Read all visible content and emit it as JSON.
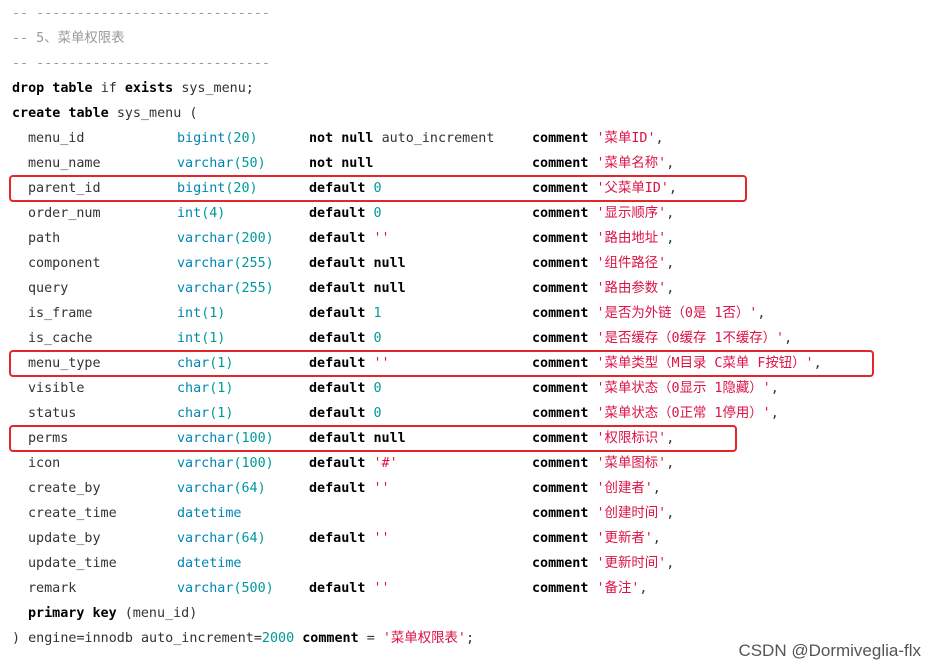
{
  "header": {
    "sep1": "-- -----------------------------",
    "title": "-- 5、菜单权限表",
    "sep2": "-- -----------------------------"
  },
  "drop": {
    "kw1": "drop table",
    "kw2": "if",
    "kw3": "exists",
    "name": "sys_menu;"
  },
  "create": {
    "kw": "create table",
    "name": "sys_menu ("
  },
  "rows": [
    {
      "name": "menu_id",
      "type": "bigint",
      "size": "(20)",
      "def_kw": "not null",
      "def_val": "auto_increment",
      "def_val_kind": "plain",
      "cmt_kw": "comment",
      "cmt": "'菜单ID'",
      "tail": ","
    },
    {
      "name": "menu_name",
      "type": "varchar",
      "size": "(50)",
      "def_kw": "not null",
      "def_val": "",
      "def_val_kind": "plain",
      "cmt_kw": "comment",
      "cmt": "'菜单名称'",
      "tail": ","
    },
    {
      "name": "parent_id",
      "type": "bigint",
      "size": "(20)",
      "def_kw": "default",
      "def_val": "0",
      "def_val_kind": "num",
      "cmt_kw": "comment",
      "cmt": "'父菜单ID'",
      "tail": ","
    },
    {
      "name": "order_num",
      "type": "int",
      "size": "(4)",
      "def_kw": "default",
      "def_val": "0",
      "def_val_kind": "num",
      "cmt_kw": "comment",
      "cmt": "'显示顺序'",
      "tail": ","
    },
    {
      "name": "path",
      "type": "varchar",
      "size": "(200)",
      "def_kw": "default",
      "def_val": "''",
      "def_val_kind": "str",
      "cmt_kw": "comment",
      "cmt": "'路由地址'",
      "tail": ","
    },
    {
      "name": "component",
      "type": "varchar",
      "size": "(255)",
      "def_kw": "default null",
      "def_val": "",
      "def_val_kind": "plain",
      "cmt_kw": "comment",
      "cmt": "'组件路径'",
      "tail": ","
    },
    {
      "name": "query",
      "type": "varchar",
      "size": "(255)",
      "def_kw": "default null",
      "def_val": "",
      "def_val_kind": "plain",
      "cmt_kw": "comment",
      "cmt": "'路由参数'",
      "tail": ","
    },
    {
      "name": "is_frame",
      "type": "int",
      "size": "(1)",
      "def_kw": "default",
      "def_val": "1",
      "def_val_kind": "num",
      "cmt_kw": "comment",
      "cmt": "'是否为外链（0是 1否）'",
      "tail": ","
    },
    {
      "name": "is_cache",
      "type": "int",
      "size": "(1)",
      "def_kw": "default",
      "def_val": "0",
      "def_val_kind": "num",
      "cmt_kw": "comment",
      "cmt": "'是否缓存（0缓存 1不缓存）'",
      "tail": ","
    },
    {
      "name": "menu_type",
      "type": "char",
      "size": "(1)",
      "def_kw": "default",
      "def_val": "''",
      "def_val_kind": "str",
      "cmt_kw": "comment",
      "cmt": "'菜单类型（M目录 C菜单 F按钮）'",
      "tail": ","
    },
    {
      "name": "visible",
      "type": "char",
      "size": "(1)",
      "def_kw": "default",
      "def_val": "0",
      "def_val_kind": "num",
      "cmt_kw": "comment",
      "cmt": "'菜单状态（0显示 1隐藏）'",
      "tail": ","
    },
    {
      "name": "status",
      "type": "char",
      "size": "(1)",
      "def_kw": "default",
      "def_val": "0",
      "def_val_kind": "num",
      "cmt_kw": "comment",
      "cmt": "'菜单状态（0正常 1停用）'",
      "tail": ","
    },
    {
      "name": "perms",
      "type": "varchar",
      "size": "(100)",
      "def_kw": "default null",
      "def_val": "",
      "def_val_kind": "plain",
      "cmt_kw": "comment",
      "cmt": "'权限标识'",
      "tail": ","
    },
    {
      "name": "icon",
      "type": "varchar",
      "size": "(100)",
      "def_kw": "default",
      "def_val": "'#'",
      "def_val_kind": "str",
      "cmt_kw": "comment",
      "cmt": "'菜单图标'",
      "tail": ","
    },
    {
      "name": "create_by",
      "type": "varchar",
      "size": "(64)",
      "def_kw": "default",
      "def_val": "''",
      "def_val_kind": "str",
      "cmt_kw": "comment",
      "cmt": "'创建者'",
      "tail": ","
    },
    {
      "name": "create_time",
      "type": "datetime",
      "size": "",
      "def_kw": "",
      "def_val": "",
      "def_val_kind": "plain",
      "cmt_kw": "comment",
      "cmt": "'创建时间'",
      "tail": ","
    },
    {
      "name": "update_by",
      "type": "varchar",
      "size": "(64)",
      "def_kw": "default",
      "def_val": "''",
      "def_val_kind": "str",
      "cmt_kw": "comment",
      "cmt": "'更新者'",
      "tail": ","
    },
    {
      "name": "update_time",
      "type": "datetime",
      "size": "",
      "def_kw": "",
      "def_val": "",
      "def_val_kind": "plain",
      "cmt_kw": "comment",
      "cmt": "'更新时间'",
      "tail": ","
    },
    {
      "name": "remark",
      "type": "varchar",
      "size": "(500)",
      "def_kw": "default",
      "def_val": "''",
      "def_val_kind": "str",
      "cmt_kw": "comment",
      "cmt": "'备注'",
      "tail": ","
    }
  ],
  "primary": {
    "kw": "primary key",
    "rest": "(menu_id)"
  },
  "footer": {
    "close": ") engine=innodb auto_increment=",
    "num": "2000",
    "kw": "comment",
    "eq": " = ",
    "str": "'菜单权限表'",
    "end": ";"
  },
  "highlights": [
    "parent_id",
    "menu_type",
    "perms"
  ],
  "highlight_color": "#e3262b",
  "watermark": "CSDN @Dormiveglia-flx"
}
